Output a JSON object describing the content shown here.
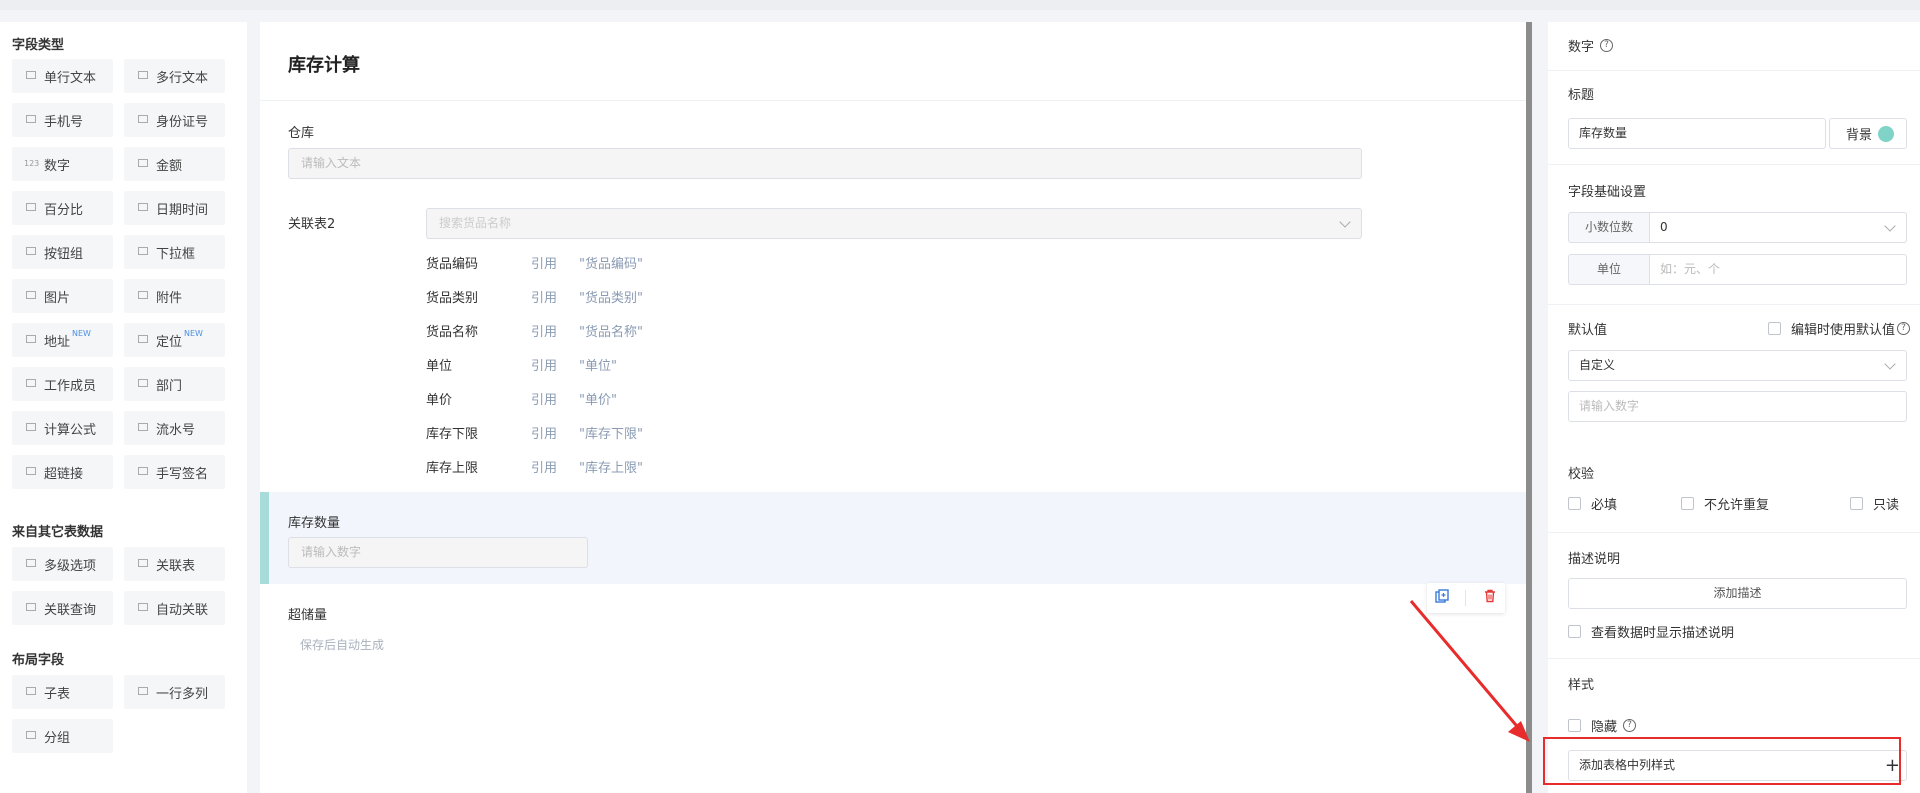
{
  "palette": {
    "sections": [
      "字段类型",
      "来自其它表数据",
      "布局字段"
    ],
    "basic_fields": [
      {
        "label": "单行文本",
        "icon": "single-line-icon"
      },
      {
        "label": "多行文本",
        "icon": "multi-line-icon"
      },
      {
        "label": "手机号",
        "icon": "phone-icon"
      },
      {
        "label": "身份证号",
        "icon": "id-card-icon"
      },
      {
        "label": "数字",
        "icon": "number-icon",
        "glyph": "123"
      },
      {
        "label": "金额",
        "icon": "money-icon"
      },
      {
        "label": "百分比",
        "icon": "percent-icon"
      },
      {
        "label": "日期时间",
        "icon": "calendar-icon"
      },
      {
        "label": "按钮组",
        "icon": "radio-icon"
      },
      {
        "label": "下拉框",
        "icon": "dropdown-icon"
      },
      {
        "label": "图片",
        "icon": "image-icon"
      },
      {
        "label": "附件",
        "icon": "attachment-icon"
      },
      {
        "label": "地址",
        "icon": "address-icon",
        "badge": "NEW"
      },
      {
        "label": "定位",
        "icon": "location-icon",
        "badge": "NEW"
      },
      {
        "label": "工作成员",
        "icon": "member-icon"
      },
      {
        "label": "部门",
        "icon": "department-icon"
      },
      {
        "label": "计算公式",
        "icon": "formula-icon"
      },
      {
        "label": "流水号",
        "icon": "serial-icon"
      },
      {
        "label": "超链接",
        "icon": "link-icon"
      },
      {
        "label": "手写签名",
        "icon": "signature-icon"
      }
    ],
    "other_fields": [
      {
        "label": "多级选项",
        "icon": "cascade-icon"
      },
      {
        "label": "关联表",
        "icon": "relation-icon"
      },
      {
        "label": "关联查询",
        "icon": "query-icon"
      },
      {
        "label": "自动关联",
        "icon": "auto-link-icon"
      }
    ],
    "layout_fields": [
      {
        "label": "子表",
        "icon": "subtable-icon"
      },
      {
        "label": "一行多列",
        "icon": "columns-icon"
      },
      {
        "label": "分组",
        "icon": "group-icon"
      }
    ]
  },
  "form": {
    "title": "库存计算",
    "warehouse": {
      "label": "仓库",
      "placeholder": "请输入文本"
    },
    "relation": {
      "label": "关联表2",
      "placeholder": "搜索货品名称",
      "refs": [
        {
          "name": "货品编码",
          "kw": "引用",
          "value": "\"货品编码\""
        },
        {
          "name": "货品类别",
          "kw": "引用",
          "value": "\"货品类别\""
        },
        {
          "name": "货品名称",
          "kw": "引用",
          "value": "\"货品名称\""
        },
        {
          "name": "单位",
          "kw": "引用",
          "value": "\"单位\""
        },
        {
          "name": "单价",
          "kw": "引用",
          "value": "\"单价\""
        },
        {
          "name": "库存下限",
          "kw": "引用",
          "value": "\"库存下限\""
        },
        {
          "name": "库存上限",
          "kw": "引用",
          "value": "\"库存上限\""
        }
      ]
    },
    "stock_qty": {
      "label": "库存数量",
      "placeholder": "请输入数字"
    },
    "overstock": {
      "label": "超储量",
      "hint": "保存后自动生成"
    }
  },
  "props": {
    "type_title": "数字",
    "title_label": "标题",
    "title_value": "库存数量",
    "bg_label": "背景",
    "bg_color": "#7fd3c7",
    "basic_settings": "字段基础设置",
    "decimals_label": "小数位数",
    "decimals_value": "0",
    "unit_label": "单位",
    "unit_placeholder": "如：元、个",
    "default_label": "默认值",
    "use_default_on_edit": "编辑时使用默认值",
    "default_mode": "自定义",
    "default_placeholder": "请输入数字",
    "validate_label": "校验",
    "required": "必填",
    "no_duplicate": "不允许重复",
    "readonly": "只读",
    "desc_label": "描述说明",
    "add_desc": "添加描述",
    "show_desc": "查看数据时显示描述说明",
    "style_label": "样式",
    "hidden": "隐藏",
    "add_col_style": "添加表格中列样式",
    "plus": "+"
  },
  "annotation_color": "#e82b2b"
}
